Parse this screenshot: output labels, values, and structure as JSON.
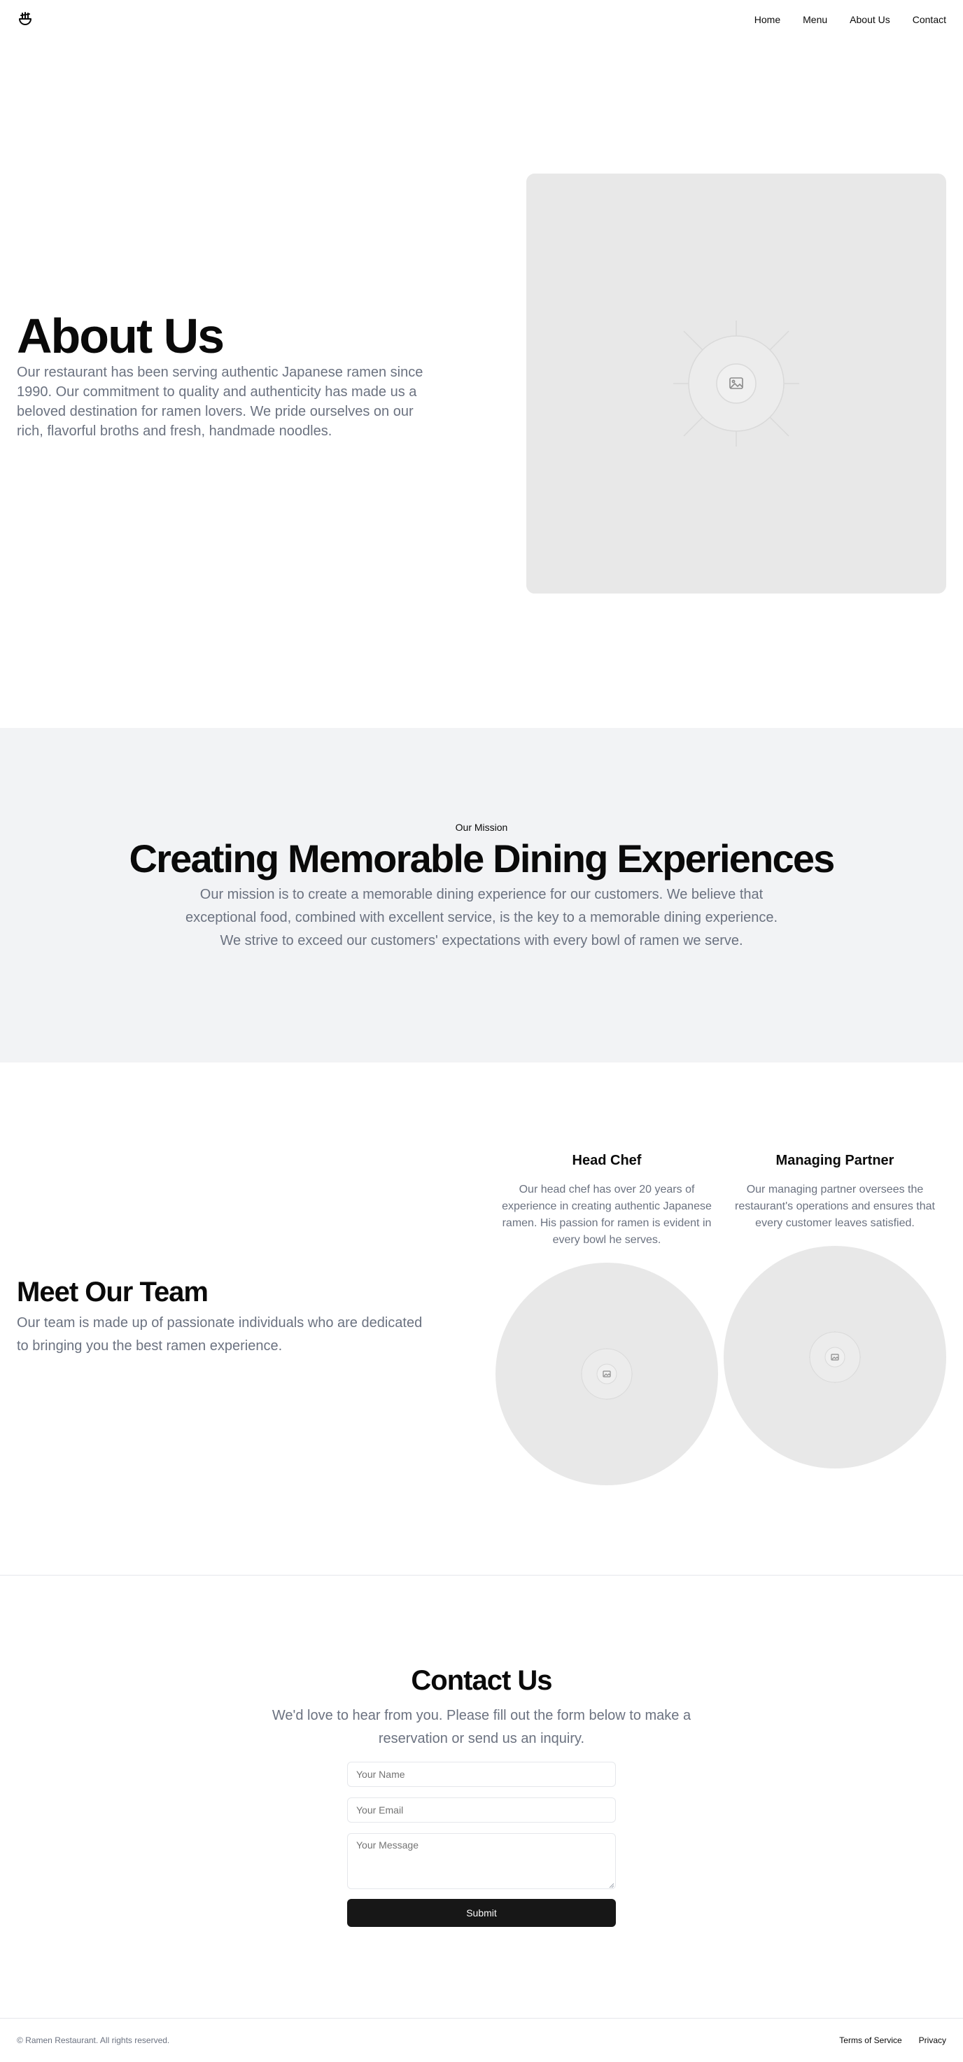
{
  "header": {
    "logo_icon": "ramen-bowl-icon",
    "nav": [
      {
        "label": "Home"
      },
      {
        "label": "Menu"
      },
      {
        "label": "About Us"
      },
      {
        "label": "Contact"
      }
    ]
  },
  "hero": {
    "title": "About Us",
    "description": "Our restaurant has been serving authentic Japanese ramen since 1990. Our commitment to quality and authenticity has made us a beloved destination for ramen lovers. We pride ourselves on our rich, flavorful broths and fresh, handmade noodles.",
    "image_icon": "image-placeholder-icon"
  },
  "mission": {
    "eyebrow": "Our Mission",
    "title": "Creating Memorable Dining Experiences",
    "description": "Our mission is to create a memorable dining experience for our customers. We believe that exceptional food, combined with excellent service, is the key to a memorable dining experience. We strive to exceed our customers' expectations with every bowl of ramen we serve."
  },
  "team": {
    "title": "Meet Our Team",
    "description": "Our team is made up of passionate individuals who are dedicated to bringing you the best ramen experience.",
    "members": [
      {
        "name": "Head Chef",
        "bio": "Our head chef has over 20 years of experience in creating authentic Japanese ramen. His passion for ramen is evident in every bowl he serves."
      },
      {
        "name": "Managing Partner",
        "bio": "Our managing partner oversees the restaurant's operations and ensures that every customer leaves satisfied."
      }
    ]
  },
  "contact": {
    "title": "Contact Us",
    "description": "We'd love to hear from you. Please fill out the form below to make a reservation or send us an inquiry.",
    "name_placeholder": "Your Name",
    "email_placeholder": "Your Email",
    "message_placeholder": "Your Message",
    "submit_label": "Submit"
  },
  "footer": {
    "copyright": "© Ramen Restaurant. All rights reserved.",
    "links": [
      {
        "label": "Terms of Service"
      },
      {
        "label": "Privacy"
      }
    ]
  },
  "colors": {
    "text": "#0a0a0a",
    "muted": "#6b7280",
    "placeholder_bg": "#e8e8e8",
    "section_bg": "#f2f3f5",
    "button": "#171717"
  }
}
